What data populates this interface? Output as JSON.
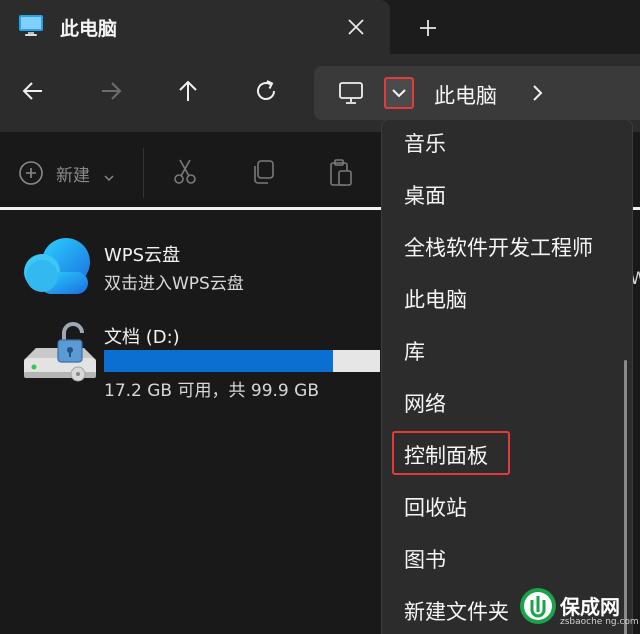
{
  "tab": {
    "title": "此电脑"
  },
  "address": {
    "location": "此电脑"
  },
  "command_bar": {
    "new_label": "新建"
  },
  "items": {
    "wps": {
      "name": "WPS云盘",
      "description": "双击进入WPS云盘",
      "overflow_char": "W"
    },
    "drive": {
      "name": "文档 (D:)",
      "free_text": "17.2 GB 可用，共 99.9 GB",
      "used_fraction": 0.828
    }
  },
  "dropdown": {
    "items": [
      "音乐",
      "桌面",
      "全栈软件开发工程师",
      "此电脑",
      "库",
      "网络",
      "控制面板",
      "回收站",
      "图书",
      "新建文件夹"
    ],
    "highlighted": "控制面板"
  },
  "watermark": {
    "title": "保成网",
    "url": "zsbaoche ng.com"
  },
  "colors": {
    "accent_blue": "#0a6fd0",
    "highlight_red": "#e23b3b",
    "watermark_green": "#1aa34a"
  },
  "icons": [
    "monitor-icon",
    "close-icon",
    "plus-icon",
    "back-arrow-icon",
    "forward-arrow-icon",
    "up-arrow-icon",
    "refresh-icon",
    "chevron-down-icon",
    "chevron-right-icon",
    "new-plus-icon",
    "cut-icon",
    "copy-icon",
    "paste-icon",
    "cloud-icon",
    "drive-lock-icon"
  ]
}
